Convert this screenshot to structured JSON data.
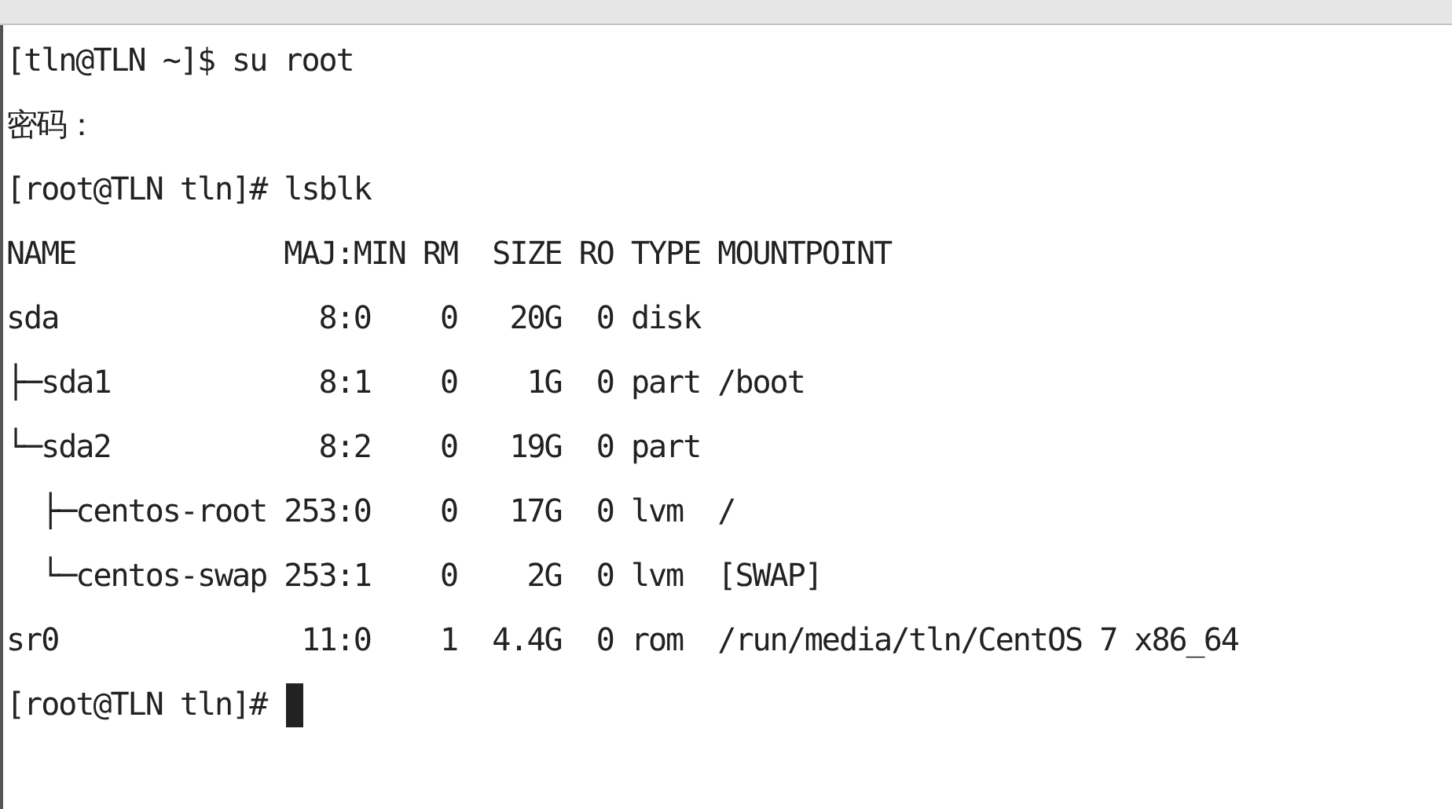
{
  "terminal": {
    "lines": [
      "[tln@TLN ~]$ su root",
      "密码：",
      "[root@TLN tln]# lsblk",
      "NAME            MAJ:MIN RM  SIZE RO TYPE MOUNTPOINT",
      "sda               8:0    0   20G  0 disk",
      "├─sda1            8:1    0    1G  0 part /boot",
      "└─sda2            8:2    0   19G  0 part",
      "  ├─centos-root 253:0    0   17G  0 lvm  /",
      "  └─centos-swap 253:1    0    2G  0 lvm  [SWAP]",
      "sr0              11:0    1  4.4G  0 rom  /run/media/tln/CentOS 7 x86_64"
    ],
    "prompt": "[root@TLN tln]#"
  }
}
